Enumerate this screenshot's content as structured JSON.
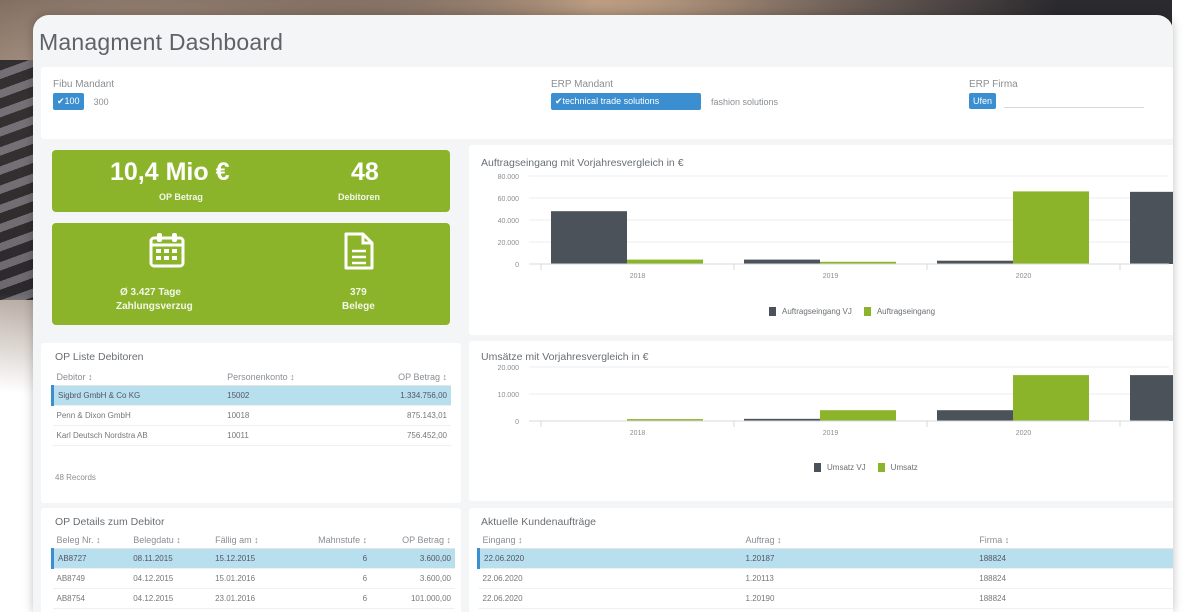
{
  "title": "Managment Dashboard",
  "filters": {
    "fibu": {
      "label": "Fibu Mandant",
      "selected": "✔100",
      "other": "300"
    },
    "erp_mandant": {
      "label": "ERP Mandant",
      "selected": "✔technical trade solutions",
      "other": "fashion solutions"
    },
    "erp_firma": {
      "label": "ERP Firma",
      "selected": "Ufen"
    }
  },
  "kpis": {
    "op_amount": {
      "value": "10,4 Mio €",
      "label": "OP Betrag"
    },
    "debtors": {
      "value": "48",
      "label": "Debitoren"
    },
    "payment_delay": {
      "line1": "Ø 3.427 Tage",
      "line2": "Zahlungsverzug",
      "icon": "calendar-icon"
    },
    "documents": {
      "line1": "379",
      "line2": "Belege",
      "icon": "document-icon"
    }
  },
  "chart_data": [
    {
      "type": "bar",
      "title": "Auftragseingang mit Vorjahresvergleich in €",
      "categories": [
        "2018",
        "2019",
        "2020"
      ],
      "ylim": [
        0,
        80000
      ],
      "yticks": [
        "80.000",
        "60.000",
        "40.000",
        "20.000",
        "0"
      ],
      "series": [
        {
          "name": "Auftragseingang VJ",
          "color": "#4b5259",
          "values": [
            48000,
            4000,
            3000
          ]
        },
        {
          "name": "Auftragseingang",
          "color": "#8bb42b",
          "values": [
            4000,
            2000,
            66000
          ]
        }
      ]
    },
    {
      "type": "bar",
      "title": "Umsätze mit Vorjahresvergleich in €",
      "categories": [
        "2018",
        "2019",
        "2020"
      ],
      "ylim": [
        0,
        20000
      ],
      "yticks": [
        "20.000",
        "10.000",
        "0"
      ],
      "series": [
        {
          "name": "Umsatz VJ",
          "color": "#4b5259",
          "values": [
            0,
            800,
            4000
          ]
        },
        {
          "name": "Umsatz",
          "color": "#8bb42b",
          "values": [
            700,
            4000,
            17000
          ]
        }
      ]
    }
  ],
  "op_list": {
    "title": "OP Liste Debitoren",
    "headers": [
      "Debitor",
      "Personenkonto",
      "OP Betrag"
    ],
    "rows": [
      [
        "Sigbrd GmbH & Co KG",
        "15002",
        "1.334.756,00"
      ],
      [
        "Penn & Dixon GmbH",
        "10018",
        "875.143,01"
      ],
      [
        "Karl Deutsch Nordstra AB",
        "10011",
        "756.452,00"
      ]
    ],
    "footer": "48 Records"
  },
  "op_details": {
    "title": "OP Details zum Debitor",
    "headers": [
      "Beleg Nr.",
      "Belegdatu",
      "Fällig am",
      "Mahnstufe",
      "OP Betrag"
    ],
    "rows": [
      [
        "AB8727",
        "08.11.2015",
        "15.12.2015",
        "6",
        "3.600,00"
      ],
      [
        "AB8749",
        "04.12.2015",
        "15.01.2016",
        "6",
        "3.600,00"
      ],
      [
        "AB8754",
        "04.12.2015",
        "23.01.2016",
        "6",
        "101.000,00"
      ]
    ]
  },
  "orders": {
    "title": "Aktuelle Kundenaufträge",
    "headers": [
      "Eingang",
      "Auftrag",
      "Firma"
    ],
    "rows": [
      [
        "22.06.2020",
        "1.20187",
        "188824"
      ],
      [
        "22.06.2020",
        "1.20113",
        "188824"
      ],
      [
        "22.06.2020",
        "1.20190",
        "188824"
      ]
    ]
  }
}
